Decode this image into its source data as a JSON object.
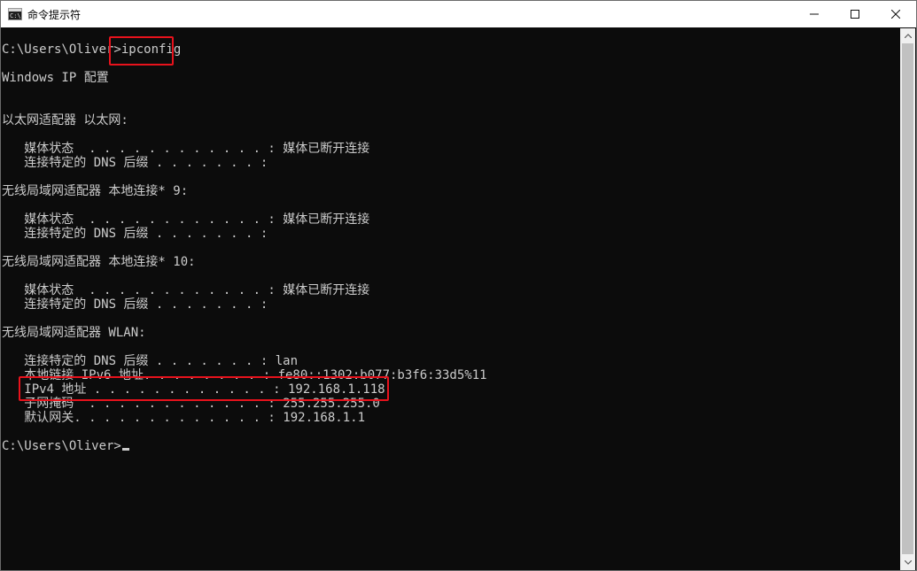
{
  "window": {
    "title": "命令提示符",
    "icon": "cmd-icon",
    "icon_text": "C:\\"
  },
  "controls": {
    "minimize": "minimize-icon",
    "maximize": "maximize-icon",
    "close": "close-icon"
  },
  "console": {
    "lines": [
      "C:\\Users\\Oliver>ipconfig",
      "",
      "Windows IP 配置",
      "",
      "",
      "以太网适配器 以太网:",
      "",
      "   媒体状态  . . . . . . . . . . . . : 媒体已断开连接",
      "   连接特定的 DNS 后缀 . . . . . . . :",
      "",
      "无线局域网适配器 本地连接* 9:",
      "",
      "   媒体状态  . . . . . . . . . . . . : 媒体已断开连接",
      "   连接特定的 DNS 后缀 . . . . . . . :",
      "",
      "无线局域网适配器 本地连接* 10:",
      "",
      "   媒体状态  . . . . . . . . . . . . : 媒体已断开连接",
      "   连接特定的 DNS 后缀 . . . . . . . :",
      "",
      "无线局域网适配器 WLAN:",
      "",
      "   连接特定的 DNS 后缀 . . . . . . . : lan",
      "   本地链接 IPv6 地址. . . . . . . . : fe80::1302:b077:b3f6:33d5%11",
      "   IPv4 地址 . . . . . . . . . . . . : 192.168.1.118",
      "   子网掩码  . . . . . . . . . . . . : 255.255.255.0",
      "   默认网关. . . . . . . . . . . . . : 192.168.1.1",
      "",
      "C:\\Users\\Oliver>"
    ]
  },
  "colors": {
    "console_bg": "#0c0c0c",
    "console_fg": "#cccccc",
    "highlight": "#e8121c"
  }
}
